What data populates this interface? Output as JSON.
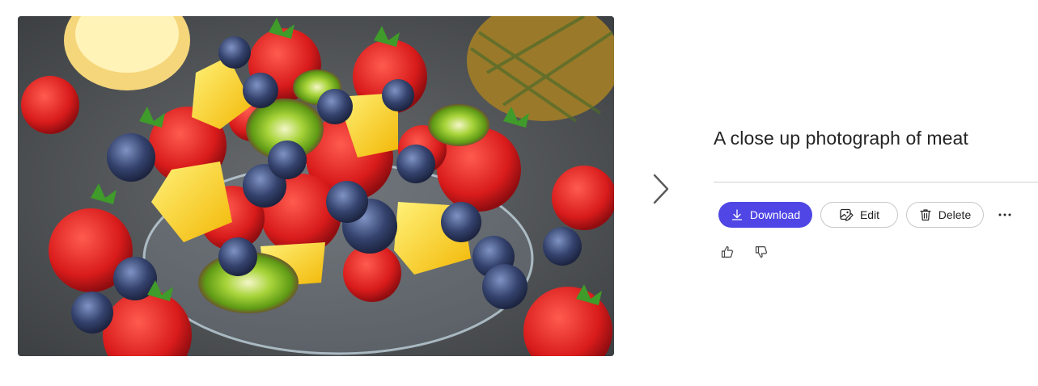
{
  "image": {
    "subject": "fruit salad bowl"
  },
  "title": "A close up photograph of meat",
  "actions": {
    "download_label": "Download",
    "edit_label": "Edit",
    "delete_label": "Delete"
  },
  "icons": {
    "next": "chevron-right-icon",
    "download": "download-icon",
    "edit": "image-edit-icon",
    "delete": "trash-icon",
    "more": "more-horizontal-icon",
    "like": "thumbs-up-icon",
    "dislike": "thumbs-down-icon"
  },
  "colors": {
    "accent": "#4f46e5",
    "title": "#242424",
    "divider": "#d1d1d1",
    "button_border": "#c8c8c8"
  }
}
